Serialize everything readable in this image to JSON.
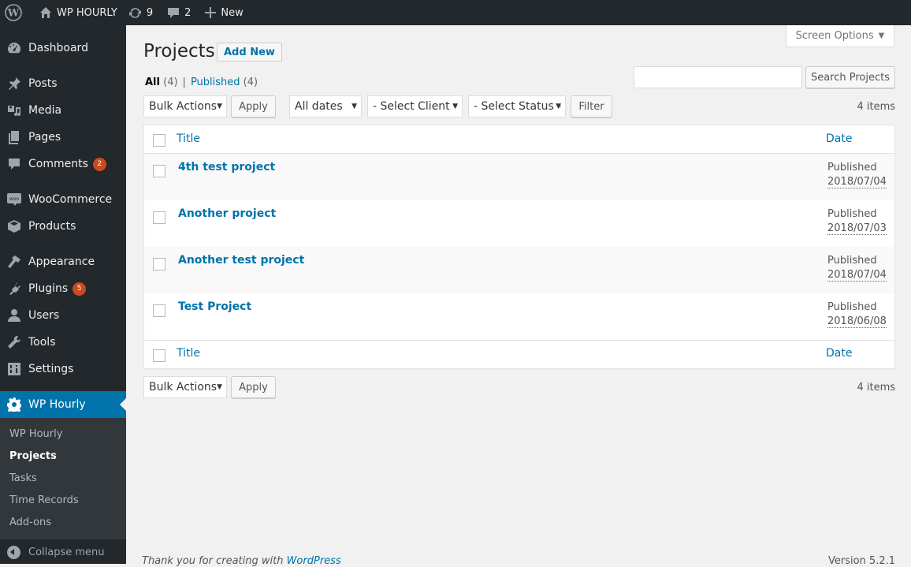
{
  "adminbar": {
    "site_name": "WP HOURLY",
    "updates_count": "9",
    "comments_count": "2",
    "new_label": "New"
  },
  "sidebar": {
    "items": [
      {
        "label": "Dashboard",
        "icon": "dashboard-icon"
      },
      {
        "label": "Posts",
        "icon": "pin-icon"
      },
      {
        "label": "Media",
        "icon": "media-icon"
      },
      {
        "label": "Pages",
        "icon": "pages-icon"
      },
      {
        "label": "Comments",
        "icon": "comment-icon",
        "badge": "2"
      },
      {
        "label": "WooCommerce",
        "icon": "woo-icon"
      },
      {
        "label": "Products",
        "icon": "box-icon"
      },
      {
        "label": "Appearance",
        "icon": "brush-icon"
      },
      {
        "label": "Plugins",
        "icon": "plug-icon",
        "badge": "5"
      },
      {
        "label": "Users",
        "icon": "user-icon"
      },
      {
        "label": "Tools",
        "icon": "wrench-icon"
      },
      {
        "label": "Settings",
        "icon": "sliders-icon"
      },
      {
        "label": "WP Hourly",
        "icon": "gear-icon",
        "current": true
      }
    ],
    "submenu": [
      "WP Hourly",
      "Projects",
      "Tasks",
      "Time Records",
      "Add-ons"
    ],
    "collapse_label": "Collapse menu"
  },
  "page": {
    "screen_options": "Screen Options",
    "title": "Projects",
    "add_new": "Add New",
    "views": {
      "all": "All",
      "all_count": "(4)",
      "published": "Published",
      "published_count": "(4)"
    },
    "search_value": "",
    "search_button": "Search Projects",
    "bulk_actions": "Bulk Actions",
    "apply": "Apply",
    "dates_filter": "All dates",
    "client_filter": "- Select Client -",
    "status_filter": "- Select Status -",
    "filter_button": "Filter",
    "items_count": "4 items"
  },
  "table": {
    "columns": {
      "title": "Title",
      "date": "Date"
    },
    "rows": [
      {
        "title": "4th test project",
        "status": "Published",
        "date": "2018/07/04"
      },
      {
        "title": "Another project",
        "status": "Published",
        "date": "2018/07/03"
      },
      {
        "title": "Another test project",
        "status": "Published",
        "date": "2018/07/04"
      },
      {
        "title": "Test Project",
        "status": "Published",
        "date": "2018/06/08"
      }
    ]
  },
  "footer": {
    "thanks": "Thank you for creating with ",
    "wp_link": "WordPress",
    "version": "Version 5.2.1"
  }
}
